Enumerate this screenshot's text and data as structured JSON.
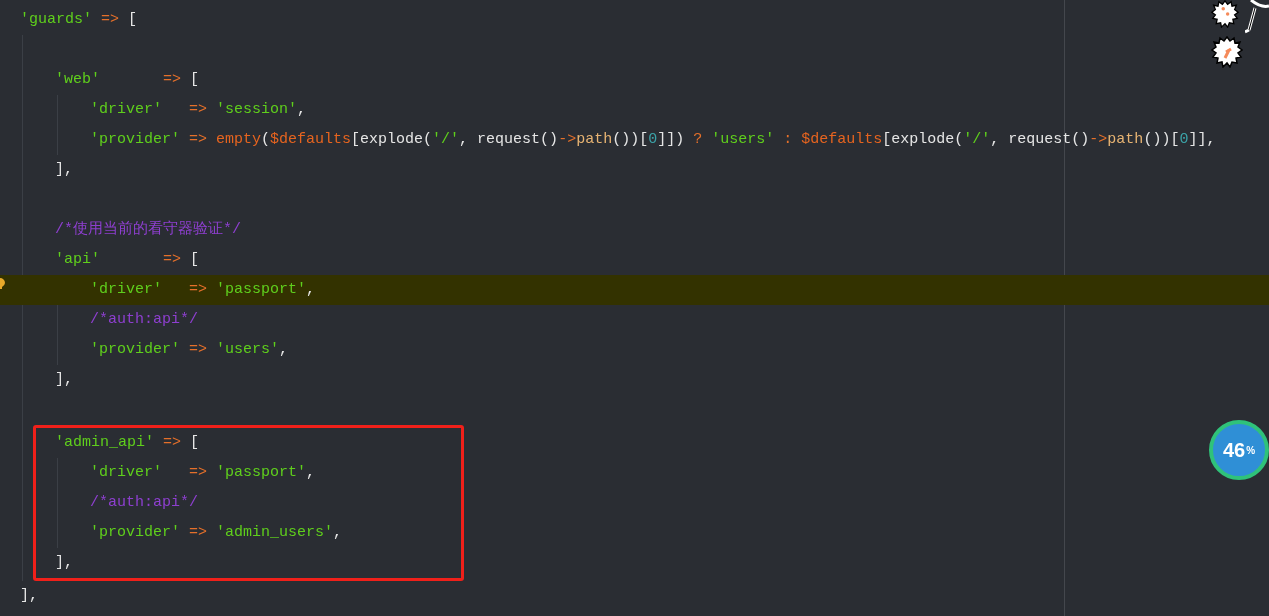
{
  "code": [
    {
      "kind": "code",
      "tokens": [
        {
          "kind": "str",
          "text": "'guards'"
        },
        {
          "kind": "op",
          "text": " => "
        },
        {
          "kind": "plain",
          "text": "["
        }
      ],
      "children": [
        {
          "kind": "blank"
        },
        {
          "kind": "code",
          "tokens": [
            {
              "kind": "str",
              "text": "'web'"
            },
            {
              "kind": "op",
              "text": "       => "
            },
            {
              "kind": "plain",
              "text": "["
            }
          ],
          "children": [
            {
              "kind": "code",
              "tokens": [
                {
                  "kind": "str",
                  "text": "'driver'"
                },
                {
                  "kind": "op",
                  "text": "   => "
                },
                {
                  "kind": "str",
                  "text": "'session'"
                },
                {
                  "kind": "plain",
                  "text": ","
                }
              ]
            },
            {
              "kind": "code",
              "tokens": [
                {
                  "kind": "str",
                  "text": "'provider'"
                },
                {
                  "kind": "op",
                  "text": " => "
                },
                {
                  "kind": "kw",
                  "text": "empty"
                },
                {
                  "kind": "plain",
                  "text": "("
                },
                {
                  "kind": "kw",
                  "text": "$defaults"
                },
                {
                  "kind": "plain",
                  "text": "[explode("
                },
                {
                  "kind": "str",
                  "text": "'/'"
                },
                {
                  "kind": "plain",
                  "text": ", request()"
                },
                {
                  "kind": "op",
                  "text": "->"
                },
                {
                  "kind": "method",
                  "text": "path"
                },
                {
                  "kind": "plain",
                  "text": "())["
                },
                {
                  "kind": "num",
                  "text": "0"
                },
                {
                  "kind": "plain",
                  "text": "]]) "
                },
                {
                  "kind": "op",
                  "text": "? "
                },
                {
                  "kind": "str",
                  "text": "'users'"
                },
                {
                  "kind": "op",
                  "text": " : "
                },
                {
                  "kind": "kw",
                  "text": "$defaults"
                },
                {
                  "kind": "plain",
                  "text": "[explode("
                },
                {
                  "kind": "str",
                  "text": "'/'"
                },
                {
                  "kind": "plain",
                  "text": ", request()"
                },
                {
                  "kind": "op",
                  "text": "->"
                },
                {
                  "kind": "method",
                  "text": "path"
                },
                {
                  "kind": "plain",
                  "text": "())["
                },
                {
                  "kind": "num",
                  "text": "0"
                },
                {
                  "kind": "plain",
                  "text": "]],"
                }
              ]
            }
          ]
        },
        {
          "kind": "code",
          "tokens": [
            {
              "kind": "plain",
              "text": "],"
            }
          ]
        },
        {
          "kind": "blank"
        },
        {
          "kind": "code",
          "tokens": [
            {
              "kind": "comment",
              "text": "/*使用当前的看守器验证*/"
            }
          ]
        },
        {
          "kind": "code",
          "tokens": [
            {
              "kind": "str",
              "text": "'api'"
            },
            {
              "kind": "op",
              "text": "       => "
            },
            {
              "kind": "plain",
              "text": "["
            }
          ],
          "children": [
            {
              "kind": "code",
              "current": true,
              "tokens": [
                {
                  "kind": "str",
                  "text": "'driver'"
                },
                {
                  "kind": "op",
                  "text": "   => "
                },
                {
                  "kind": "str",
                  "text": "'passport'"
                },
                {
                  "kind": "plain",
                  "text": ","
                }
              ]
            },
            {
              "kind": "code",
              "tokens": [
                {
                  "kind": "comment",
                  "text": "/*auth:api*/"
                }
              ]
            },
            {
              "kind": "code",
              "tokens": [
                {
                  "kind": "str",
                  "text": "'provider'"
                },
                {
                  "kind": "op",
                  "text": " => "
                },
                {
                  "kind": "str",
                  "text": "'users'"
                },
                {
                  "kind": "plain",
                  "text": ","
                }
              ]
            }
          ]
        },
        {
          "kind": "code",
          "tokens": [
            {
              "kind": "plain",
              "text": "],"
            }
          ]
        },
        {
          "kind": "blank"
        },
        {
          "kind": "code",
          "boxed": true,
          "tokens": [
            {
              "kind": "str",
              "text": "'admin_api'"
            },
            {
              "kind": "op",
              "text": " => "
            },
            {
              "kind": "plain",
              "text": "["
            }
          ],
          "children": [
            {
              "kind": "code",
              "tokens": [
                {
                  "kind": "str",
                  "text": "'driver'"
                },
                {
                  "kind": "op",
                  "text": "   => "
                },
                {
                  "kind": "str",
                  "text": "'passport'"
                },
                {
                  "kind": "plain",
                  "text": ","
                }
              ]
            },
            {
              "kind": "code",
              "tokens": [
                {
                  "kind": "comment",
                  "text": "/*auth:api*/"
                }
              ]
            },
            {
              "kind": "code",
              "tokens": [
                {
                  "kind": "str",
                  "text": "'provider'"
                },
                {
                  "kind": "op",
                  "text": " => "
                },
                {
                  "kind": "str",
                  "text": "'admin_users'"
                },
                {
                  "kind": "plain",
                  "text": ","
                }
              ]
            }
          ]
        },
        {
          "kind": "code",
          "boxed": true,
          "tokens": [
            {
              "kind": "plain",
              "text": "],"
            }
          ]
        }
      ]
    },
    {
      "kind": "code",
      "tokens": [
        {
          "kind": "plain",
          "text": "],"
        }
      ]
    }
  ],
  "overlay_widget": {
    "value": "46",
    "unit": "%"
  }
}
